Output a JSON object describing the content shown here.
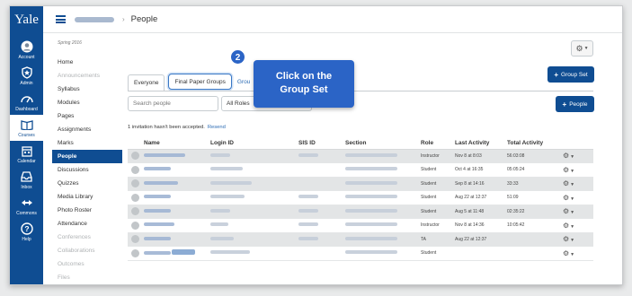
{
  "global_nav": {
    "logo": "Yale",
    "items": [
      {
        "label": "Account",
        "icon": "account-icon"
      },
      {
        "label": "Admin",
        "icon": "admin-shield-icon"
      },
      {
        "label": "Dashboard",
        "icon": "dashboard-icon"
      },
      {
        "label": "Courses",
        "icon": "courses-book-icon",
        "active": true
      },
      {
        "label": "Calendar",
        "icon": "calendar-icon"
      },
      {
        "label": "Inbox",
        "icon": "inbox-icon"
      },
      {
        "label": "Commons",
        "icon": "commons-icon"
      },
      {
        "label": "Help",
        "icon": "help-icon"
      }
    ]
  },
  "breadcrumb": {
    "page": "People",
    "separator": "›"
  },
  "course_nav": {
    "term": "Spring 2016",
    "items": [
      {
        "label": "Home"
      },
      {
        "label": "Announcements",
        "muted": true
      },
      {
        "label": "Syllabus"
      },
      {
        "label": "Modules"
      },
      {
        "label": "Pages"
      },
      {
        "label": "Assignments"
      },
      {
        "label": "Marks"
      },
      {
        "label": "People",
        "active": true
      },
      {
        "label": "Discussions"
      },
      {
        "label": "Quizzes"
      },
      {
        "label": "Media Library"
      },
      {
        "label": "Photo Roster"
      },
      {
        "label": "Attendance"
      },
      {
        "label": "Conferences",
        "muted": true
      },
      {
        "label": "Collaborations",
        "muted": true
      },
      {
        "label": "Outcomes",
        "muted": true
      },
      {
        "label": "Files",
        "muted": true
      }
    ]
  },
  "tabs": {
    "everyone": "Everyone",
    "final_paper_groups": "Final Paper Groups",
    "group_partial": "Grou",
    "extra_partial": "dsf"
  },
  "buttons": {
    "group_set": "Group Set",
    "people": "People",
    "plus": "+"
  },
  "search": {
    "placeholder": "Search people"
  },
  "roles_select": {
    "value": "All Roles"
  },
  "invite": {
    "text": "1 invitation hasn't been accepted.",
    "resend": "Resend"
  },
  "table": {
    "headers": [
      "Name",
      "Login ID",
      "SIS ID",
      "Section",
      "Role",
      "Last Activity",
      "Total Activity"
    ],
    "rows": [
      {
        "role": "Instructor",
        "last_activity": "Nov 8 at 8:03",
        "total_activity": "56:03:08",
        "has_sis": true
      },
      {
        "role": "Student",
        "last_activity": "Oct 4 at 16:35",
        "total_activity": "05:05:24",
        "has_sis": false
      },
      {
        "role": "Student",
        "last_activity": "Sep 8 at 14:16",
        "total_activity": "33:33",
        "has_sis": false
      },
      {
        "role": "Student",
        "last_activity": "Aug 22 at 12:37",
        "total_activity": "51:09",
        "has_sis": true
      },
      {
        "role": "Student",
        "last_activity": "Aug 5 at 11:48",
        "total_activity": "02:35:22",
        "has_sis": true
      },
      {
        "role": "Instructor",
        "last_activity": "Nov 8 at 14:36",
        "total_activity": "10:05:42",
        "has_sis": true
      },
      {
        "role": "TA",
        "last_activity": "Aug 22 at 12:37",
        "total_activity": "",
        "has_sis": true
      },
      {
        "role": "Student",
        "last_activity": "",
        "total_activity": "",
        "has_sis": false
      }
    ]
  },
  "callout": {
    "step": "2",
    "line1": "Click on the",
    "line2": "Group Set"
  },
  "colors": {
    "nav": "#0f4d92",
    "callout": "#2b64c6",
    "link": "#2d6db5"
  }
}
